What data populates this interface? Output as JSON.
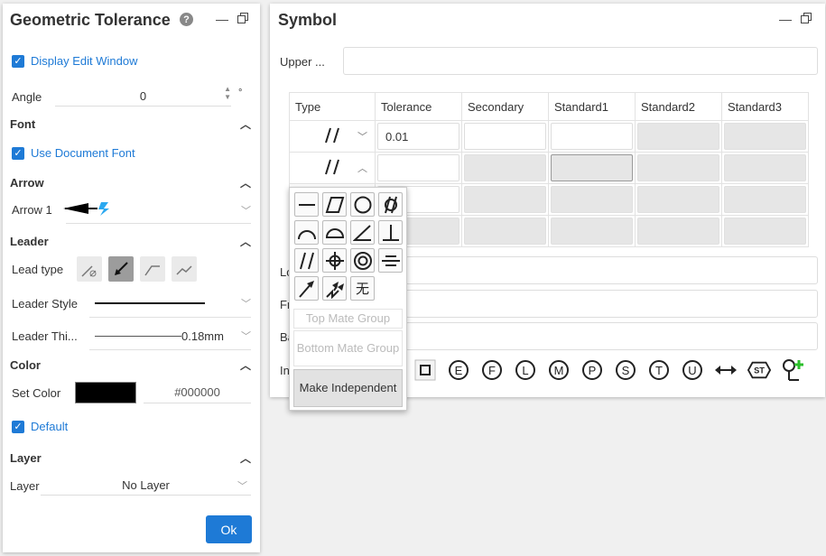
{
  "left": {
    "title": "Geometric Tolerance",
    "help_icon": "question-circle-icon",
    "display_edit_window": "Display Edit Window",
    "angle_label": "Angle",
    "angle_value": "0",
    "angle_unit": "°",
    "font_section": "Font",
    "use_document_font": "Use Document Font",
    "arrow_section": "Arrow",
    "arrow_label": "Arrow 1",
    "leader_section": "Leader",
    "lead_type_label": "Lead type",
    "leader_style_label": "Leader Style",
    "leader_thickness_label": "Leader Thi...",
    "leader_thickness_value": "0.18mm",
    "color_section": "Color",
    "set_color_label": "Set Color",
    "color_hex": "#000000",
    "color_swatch": "#000000",
    "default_label": "Default",
    "layer_section": "Layer",
    "layer_label": "Layer",
    "layer_value": "No Layer",
    "ok_label": "Ok"
  },
  "right": {
    "title": "Symbol",
    "upper_label": "Upper ...",
    "table": {
      "headers": [
        "Type",
        "Tolerance",
        "Secondary",
        "Standard1",
        "Standard2",
        "Standard3"
      ],
      "row1_tolerance": "0.01"
    },
    "lower_labels": [
      "Lo",
      "Fr",
      "Ba",
      "In"
    ]
  },
  "popup": {
    "top_mate_group": "Top Mate Group",
    "bottom_mate_group": "Bottom Mate Group",
    "make_independent": "Make Independent",
    "symbols": [
      "straightness",
      "flatness",
      "circularity",
      "cylindricity",
      "profile-line",
      "profile-surface",
      "angularity",
      "perpendicularity",
      "parallelism",
      "position",
      "concentricity",
      "symmetry",
      "circular-runout",
      "total-runout",
      "none"
    ],
    "none_symbol_text": "无"
  },
  "indicators": {
    "letters": [
      "E",
      "F",
      "L",
      "M",
      "P",
      "S",
      "T",
      "U"
    ],
    "st_text": "ST"
  },
  "colors": {
    "accent": "#1e7ad6",
    "arrow_accent": "#2aa8f0",
    "plus_green": "#2bbf2b"
  }
}
